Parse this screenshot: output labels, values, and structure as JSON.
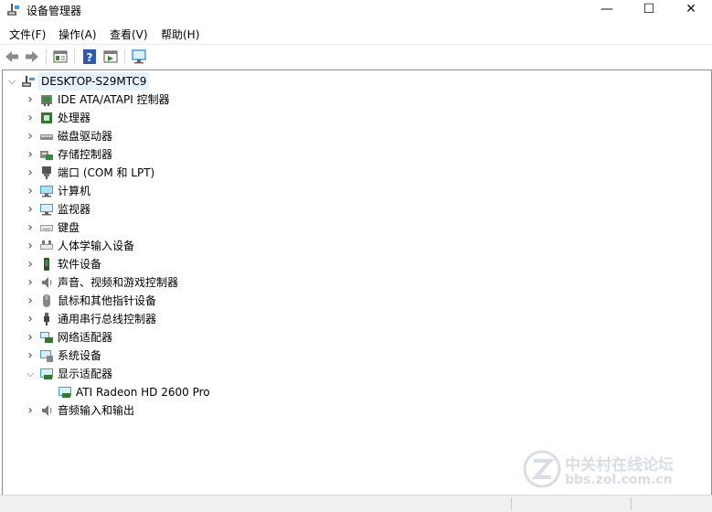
{
  "window": {
    "title": "设备管理器",
    "controls": {
      "minimize": "—",
      "maximize": "☐",
      "close": "✕"
    }
  },
  "menu": [
    "文件(F)",
    "操作(A)",
    "查看(V)",
    "帮助(H)"
  ],
  "toolbar": {
    "buttons": [
      "back-arrow-icon",
      "forward-arrow-icon",
      "properties-icon",
      "help-icon",
      "update-driver-icon",
      "monitor-scan-icon"
    ]
  },
  "tree": {
    "root": {
      "label": "DESKTOP-S29MTC9",
      "expanded": true
    },
    "items": [
      {
        "label": "IDE ATA/ATAPI 控制器",
        "icon": "ide-controller-icon",
        "expanded": false
      },
      {
        "label": "处理器",
        "icon": "processor-icon",
        "expanded": false
      },
      {
        "label": "磁盘驱动器",
        "icon": "disk-drive-icon",
        "expanded": false
      },
      {
        "label": "存储控制器",
        "icon": "storage-controller-icon",
        "expanded": false
      },
      {
        "label": "端口 (COM 和 LPT)",
        "icon": "port-icon",
        "expanded": false
      },
      {
        "label": "计算机",
        "icon": "computer-icon",
        "expanded": false
      },
      {
        "label": "监视器",
        "icon": "monitor-icon",
        "expanded": false
      },
      {
        "label": "键盘",
        "icon": "keyboard-icon",
        "expanded": false
      },
      {
        "label": "人体学输入设备",
        "icon": "hid-icon",
        "expanded": false
      },
      {
        "label": "软件设备",
        "icon": "software-device-icon",
        "expanded": false
      },
      {
        "label": "声音、视频和游戏控制器",
        "icon": "sound-icon",
        "expanded": false
      },
      {
        "label": "鼠标和其他指针设备",
        "icon": "mouse-icon",
        "expanded": false
      },
      {
        "label": "通用串行总线控制器",
        "icon": "usb-icon",
        "expanded": false
      },
      {
        "label": "网络适配器",
        "icon": "network-adapter-icon",
        "expanded": false
      },
      {
        "label": "系统设备",
        "icon": "system-device-icon",
        "expanded": false
      },
      {
        "label": "显示适配器",
        "icon": "display-adapter-icon",
        "expanded": true,
        "children": [
          {
            "label": "ATI Radeon HD 2600 Pro",
            "icon": "display-adapter-icon"
          }
        ]
      },
      {
        "label": "音频输入和输出",
        "icon": "audio-io-icon",
        "expanded": false
      }
    ]
  },
  "watermark": {
    "line1": "中关村在线论坛",
    "line2": "bbs.zol.com.cn"
  },
  "colors": {
    "selection": "#e5f1fb",
    "accent": "#3c9fe0",
    "border": "#8c8c8c"
  }
}
